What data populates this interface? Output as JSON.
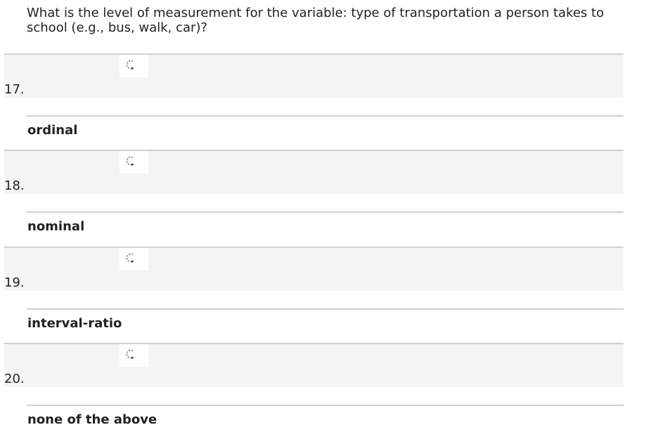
{
  "question": {
    "text": "What is the level of measurement for the variable: type of transportation a person takes to school (e.g., bus, walk, car)?"
  },
  "options": [
    {
      "number": "17.",
      "label": "ordinal",
      "icon": "radio-button-icon"
    },
    {
      "number": "18.",
      "label": "nominal",
      "icon": "radio-button-icon"
    },
    {
      "number": "19.",
      "label": "interval-ratio",
      "icon": "radio-button-icon"
    },
    {
      "number": "20.",
      "label": "none of the above",
      "icon": "radio-button-icon"
    }
  ],
  "colors": {
    "rule": "#d0d0d0",
    "band": "#f4f4f4",
    "text": "#222222"
  }
}
